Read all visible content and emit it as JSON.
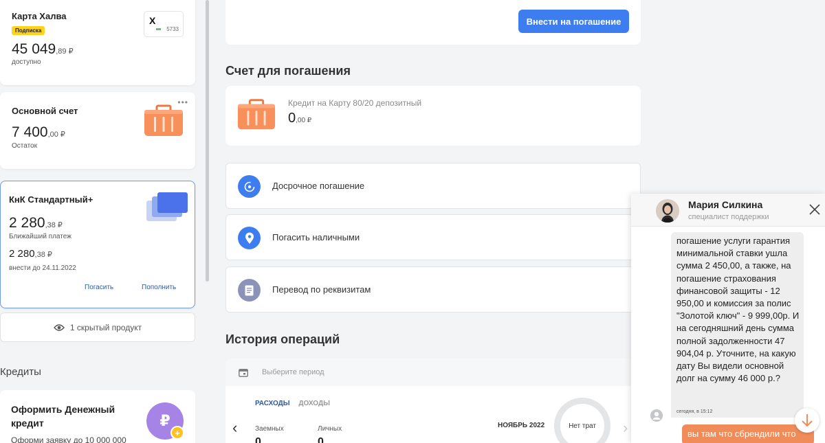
{
  "products": {
    "halva": {
      "title": "Карта Халва",
      "badge": "Подписка",
      "amount_int": "45 049",
      "amount_frac": ",89 ₽",
      "caption": "доступно",
      "card_logo": "Х",
      "card_last4": "5733"
    },
    "main_account": {
      "title": "Основной счет",
      "more": "•••",
      "amount_int": "7 400",
      "amount_frac": ",00 ₽",
      "caption": "Остаток"
    },
    "knk": {
      "title": "КнК Стандартный+",
      "amount_int": "2 280",
      "amount_frac": ",38 ₽",
      "caption": "Ближайший платеж",
      "amount2_int": "2 280",
      "amount2_frac": ",38 ₽",
      "due": "внести до 24.11.2022",
      "pay_link": "Погасить",
      "topup_link": "Пополнить"
    },
    "hidden": "1 скрытый продукт"
  },
  "credits": {
    "title": "Кредиты",
    "card_title": "Оформить Денежный кредит",
    "card_sub": "Оформи заявку до 10 000 000",
    "icon_symbol": "₽",
    "plus_symbol": "+"
  },
  "repay": {
    "button": "Внести на погашение",
    "section_title": "Счет для погашения",
    "account_label": "Кредит на Карту 80/20 депозитный",
    "account_int": "0",
    "account_frac": ",00 ₽"
  },
  "options": [
    {
      "label": "Досрочное погашение",
      "icon": "early-repay-icon",
      "color": "#3d7df0"
    },
    {
      "label": "Погасить наличными",
      "icon": "location-pin-icon",
      "color": "#3d7df0"
    },
    {
      "label": "Перевод по реквизитам",
      "icon": "document-icon",
      "color": "#8c93b8"
    }
  ],
  "history": {
    "title": "История операций",
    "period_placeholder": "Выберите период",
    "tab_expenses": "РАСХОДЫ",
    "tab_income": "ДОХОДЫ",
    "col1_label": "Заемных",
    "col1_value": "0",
    "col2_label": "Личных",
    "col2_value": "0",
    "month": "НОЯБРЬ 2022",
    "ring_text": "Нет трат"
  },
  "chat": {
    "agent_name": "Мария Силкина",
    "agent_role": "специалист поддержки",
    "message": "погашение услуги гарантия минимальной ставки ушла сумма 2 450,00, а также, на погашение страхования финансовой защиты - 12 950,00 и комиссия за полис \"Золотой ключ\" - 9 999,00р. И на сегодняшний день сумма полной задолженности 47 904,04 р. Уточните, на какую дату Вы видели основной долг на сумму 46 000 р.?",
    "message_time": "сегодня, в 15:12",
    "outgoing": "вы там что сбрендили что"
  },
  "colors": {
    "accent": "#3d7df0",
    "badge": "#ffd21e",
    "briefcase": "#f7905a",
    "outgoing": "#f08c5a"
  }
}
